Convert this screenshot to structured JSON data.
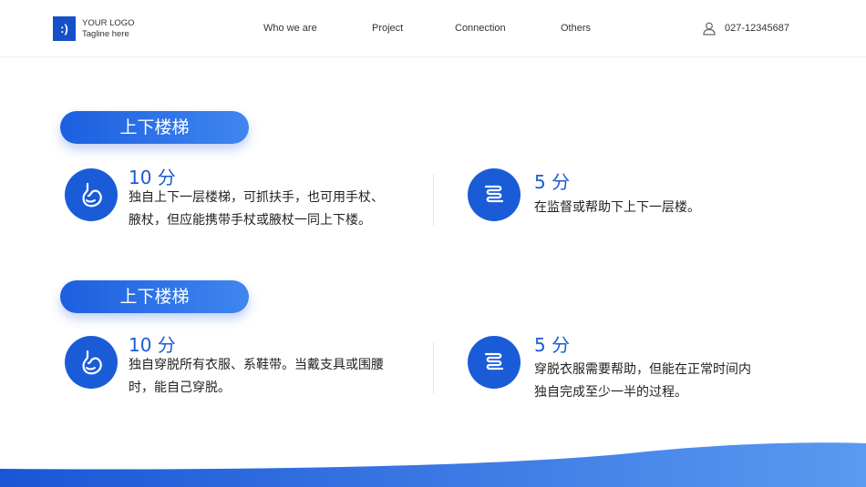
{
  "header": {
    "logo_mark": ":)",
    "logo_title": "YOUR LOGO",
    "logo_tagline": "Tagline here",
    "nav": [
      "Who we are",
      "Project",
      "Connection",
      "Others"
    ],
    "phone": "027-12345687",
    "phone_icon": "user-phone-icon"
  },
  "sections": [
    {
      "title": "上下楼梯",
      "items": [
        {
          "score": "10 分",
          "line1": "独自上下一层楼梯，可抓扶手，也可用手杖、",
          "line2": "腋杖，但应能携带手杖或腋杖一同上下楼。",
          "icon": "stomach-icon"
        },
        {
          "score": "5 分",
          "line1": "在监督或帮助下上下一层楼。",
          "line2": "",
          "icon": "intestine-icon"
        }
      ]
    },
    {
      "title": "上下楼梯",
      "items": [
        {
          "score": "10 分",
          "line1": "独自穿脱所有衣服、系鞋带。当戴支具或围腰",
          "line2": "时，能自己穿脱。",
          "icon": "stomach-icon"
        },
        {
          "score": "5 分",
          "line1": "穿脱衣服需要帮助，但能在正常时间内",
          "line2": "独自完成至少一半的过程。",
          "icon": "intestine-icon"
        }
      ]
    }
  ],
  "colors": {
    "accent": "#1a5cd8",
    "accent_light": "#3f86ef"
  }
}
